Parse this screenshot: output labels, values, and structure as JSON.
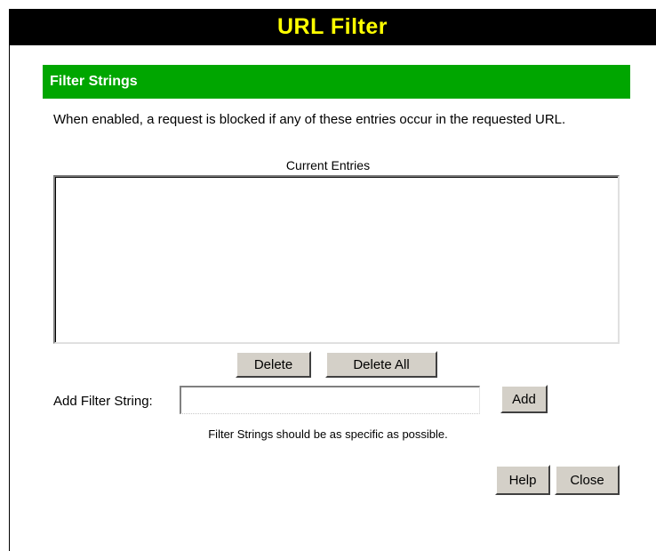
{
  "window": {
    "title": "URL Filter"
  },
  "section": {
    "title": "Filter Strings"
  },
  "description": "When enabled, a request is blocked if any of these entries occur in the requested URL.",
  "entries": {
    "label": "Current Entries",
    "items": []
  },
  "buttons": {
    "delete": "Delete",
    "delete_all": "Delete All",
    "add": "Add",
    "help": "Help",
    "close": "Close"
  },
  "add_filter": {
    "label": "Add Filter String:",
    "value": ""
  },
  "hint": "Filter Strings should be as specific as possible.",
  "colors": {
    "titlebar": "#000000",
    "title_text": "#ffff00",
    "section": "#00a600"
  }
}
